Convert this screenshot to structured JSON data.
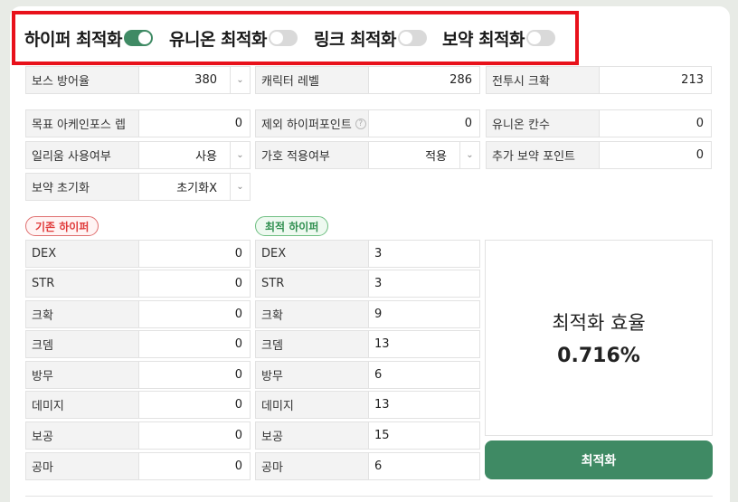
{
  "toggles": [
    {
      "label": "하이퍼 최적화",
      "on": true
    },
    {
      "label": "유니온 최적화",
      "on": false
    },
    {
      "label": "링크 최적화",
      "on": false
    },
    {
      "label": "보약 최적화",
      "on": false
    }
  ],
  "settings": {
    "boss_def": {
      "label": "보스 방어율",
      "value": "380"
    },
    "char_level": {
      "label": "캐릭터 레벨",
      "value": "286"
    },
    "combat_crit": {
      "label": "전투시 크확",
      "value": "213"
    },
    "target_arcane": {
      "label": "목표 아케인포스 렙",
      "value": "0"
    },
    "excluded_hyper": {
      "label": "제외 하이퍼포인트",
      "value": "0",
      "help": "?"
    },
    "union_slots": {
      "label": "유니온 칸수",
      "value": "0"
    },
    "ilium": {
      "label": "일리움 사용여부",
      "value": "사용"
    },
    "guardian": {
      "label": "가호 적용여부",
      "value": "적용"
    },
    "extra_potion": {
      "label": "추가 보약 포인트",
      "value": "0"
    },
    "potion_reset": {
      "label": "보약 초기화",
      "value": "초기화X"
    }
  },
  "current_hyper": {
    "badge": "기존 하이퍼",
    "rows": [
      {
        "label": "DEX",
        "value": "0"
      },
      {
        "label": "STR",
        "value": "0"
      },
      {
        "label": "크확",
        "value": "0"
      },
      {
        "label": "크뎀",
        "value": "0"
      },
      {
        "label": "방무",
        "value": "0"
      },
      {
        "label": "데미지",
        "value": "0"
      },
      {
        "label": "보공",
        "value": "0"
      },
      {
        "label": "공마",
        "value": "0"
      }
    ]
  },
  "optimal_hyper": {
    "badge": "최적 하이퍼",
    "rows": [
      {
        "label": "DEX",
        "value": "3"
      },
      {
        "label": "STR",
        "value": "3"
      },
      {
        "label": "크확",
        "value": "9"
      },
      {
        "label": "크뎀",
        "value": "13"
      },
      {
        "label": "방무",
        "value": "6"
      },
      {
        "label": "데미지",
        "value": "13"
      },
      {
        "label": "보공",
        "value": "15"
      },
      {
        "label": "공마",
        "value": "6"
      }
    ]
  },
  "result": {
    "title": "최적화 효율",
    "value": "0.716%"
  },
  "optimize_button": "최적화",
  "colors": {
    "accent": "#3f8a64",
    "highlight_border": "#e8111b"
  }
}
